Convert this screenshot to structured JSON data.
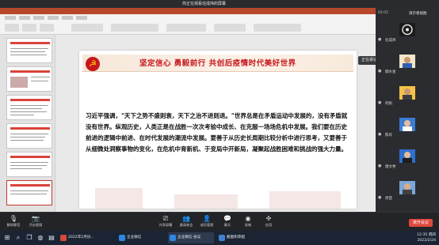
{
  "notice": {
    "text": "你正在观看任成炜的屏幕"
  },
  "slide": {
    "heading": "坚定信心 勇毅前行 共创后疫情时代美好世界",
    "body": "习近平强调，\"天下之势不盛则衰，天下之治不进则退。\"世界总是在矛盾运动中发展的，没有矛盾就没有世界。纵观历史，人类正是在战胜一次次考验中成长、在克服一场场危机中发展。我们要在历史前进的逻辑中前进、在时代发展的潮流中发展。要善于从历史长周期比较分析中进行思考，又要善于从细微处洞察事物的变化，在危机中育新机、于变局中开新局，凝聚起战胜困难和挑战的强大力量。"
  },
  "panel": {
    "time": "02:02",
    "label": "演示者视图",
    "participants": [
      {
        "name": "任成炜",
        "avatar": "wheel-icon"
      },
      {
        "name": "鄢水金",
        "avatar": "person-icon"
      },
      {
        "name": "何帆",
        "avatar": "person-icon"
      },
      {
        "name": "陈欢",
        "avatar": "person-icon"
      },
      {
        "name": "唐文秀",
        "avatar": "person-icon"
      },
      {
        "name": "周芸",
        "avatar": "person-icon"
      }
    ],
    "tooltip": "正在讲话：任成炜"
  },
  "toolbar": {
    "left": [
      {
        "label": "解除静音",
        "icon": "mic-off-icon"
      },
      {
        "label": "开启视频",
        "icon": "camera-off-icon"
      }
    ],
    "center": [
      {
        "label": "共享屏幕",
        "icon": "share-screen-icon"
      },
      {
        "label": "邀请参会",
        "icon": "invite-icon"
      },
      {
        "label": "成员管理",
        "icon": "members-icon"
      },
      {
        "label": "聊天",
        "icon": "chat-icon"
      },
      {
        "label": "录制",
        "icon": "record-icon"
      },
      {
        "label": "应用",
        "icon": "apps-icon"
      }
    ],
    "end_label": "离开会议"
  },
  "taskbar": {
    "apps": [
      {
        "label": "2022年2月份...",
        "color": "#d24a3a"
      },
      {
        "label": "企业微信",
        "color": "#2f86e3"
      },
      {
        "label": "企业微信-会议",
        "color": "#2f86e3"
      },
      {
        "label": "截图和草图",
        "color": "#3f7fcf"
      }
    ],
    "time": "12:35 周四",
    "date": "2022/2/24"
  },
  "colors": {
    "accent_red": "#c8161d",
    "end_button": "#e0483e"
  }
}
